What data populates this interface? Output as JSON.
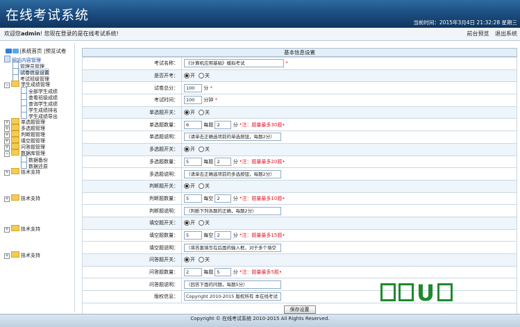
{
  "header": {
    "title": "在线考试系统",
    "time": "当前时间：2015年3月4日  21:32:28 星期三"
  },
  "userbar": {
    "welcome_prefix": "欢迎您",
    "user": "admin",
    "welcome_suffix": "! 您现在登录的是在线考试系统!",
    "link_preview": "前台预览",
    "link_logout": "退出系统"
  },
  "sidebar": {
    "toolbar": "|系统首页 |预览试卷",
    "tree": {
      "root": "网站内容管理",
      "items": [
        "管理员管理",
        "试卷信息设置",
        "考试班级管理"
      ],
      "student_group": "学生成绩管理",
      "student_items": [
        "全部学生成绩",
        "查看班级成绩",
        "查询学生成绩",
        "学生成绩排名",
        "学生成绩导出"
      ],
      "groups": [
        "单选题管理",
        "多选题管理",
        "判断题管理",
        "填空题管理",
        "问答题管理"
      ],
      "db_group": "数据库管理",
      "db_items": [
        "数据备份",
        "数据还原"
      ],
      "support": [
        "技术支持",
        "技术支持",
        "技术支持",
        "技术支持"
      ]
    }
  },
  "form": {
    "section_title": "基本信息设置",
    "exam_name": {
      "label": "考试名称：",
      "value": "《计算机应用基础》模拟考试",
      "required": "*"
    },
    "open": {
      "label": "是否开考：",
      "on": "开",
      "off": "关"
    },
    "total": {
      "label": "试卷总分：",
      "value": "100",
      "unit": "分",
      "required": "*"
    },
    "time": {
      "label": "考试时间：",
      "value": "100",
      "unit": "分钟",
      "required": "*"
    },
    "single_switch": {
      "label": "单选题开关：",
      "on": "开",
      "off": "关"
    },
    "single_count": {
      "label": "单选题数量：",
      "count": "6",
      "mid": "每题",
      "score": "2",
      "unit": "分",
      "note": "*注：题量最多30题•"
    },
    "single_desc": {
      "label": "单选题说明：",
      "value": "（请单击正确选项前的单选按钮，每题2分）"
    },
    "multi_switch": {
      "label": "多选题开关：",
      "on": "开",
      "off": "关"
    },
    "multi_count": {
      "label": "多选题数量：",
      "count": "5",
      "mid": "每题",
      "score": "2",
      "unit": "分",
      "note": "*注：题量最多20题•"
    },
    "multi_desc": {
      "label": "多选题说明：",
      "value": "（请单击正确选项前的多选按钮，每题2分）"
    },
    "judge_switch": {
      "label": "判断题开关：",
      "on": "开",
      "off": "关"
    },
    "judge_count": {
      "label": "判断题数量：",
      "count": "5",
      "mid": "每空",
      "score": "2",
      "unit": "分",
      "note": "*注：题量最多10题•"
    },
    "judge_desc": {
      "label": "判断题说明：",
      "value": "（判断下列各题的正确，每题2分）"
    },
    "fill_switch": {
      "label": "填空题开关：",
      "on": "开",
      "off": "关"
    },
    "fill_count": {
      "label": "填空题数量：",
      "count": "5",
      "mid": "每空",
      "score": "2",
      "unit": "分",
      "note": "*注：题量最多15题•"
    },
    "fill_desc": {
      "label": "填空题说明：",
      "value": "（将答案填写在后面的输入框，对于多个填空"
    },
    "qa_switch": {
      "label": "问答题开关：",
      "on": "开",
      "off": "关"
    },
    "qa_count": {
      "label": "问答题数量：",
      "count": "2",
      "mid": "每题",
      "score": "5",
      "unit": "分",
      "note": "*注：题量最多5题•"
    },
    "qa_desc": {
      "label": "问答题说明：",
      "value": "（回答下面的问题，每题5分）"
    },
    "copyright": {
      "label": "版权信息：",
      "value": "Copyright 2010-2015  版权所有  本在线考试"
    },
    "save_label": "保存设置"
  },
  "footer": {
    "text": "Copyright © 在线考试系统  2010-2015 All Rights Reserved."
  },
  "watermark": {
    "letter": "U"
  }
}
